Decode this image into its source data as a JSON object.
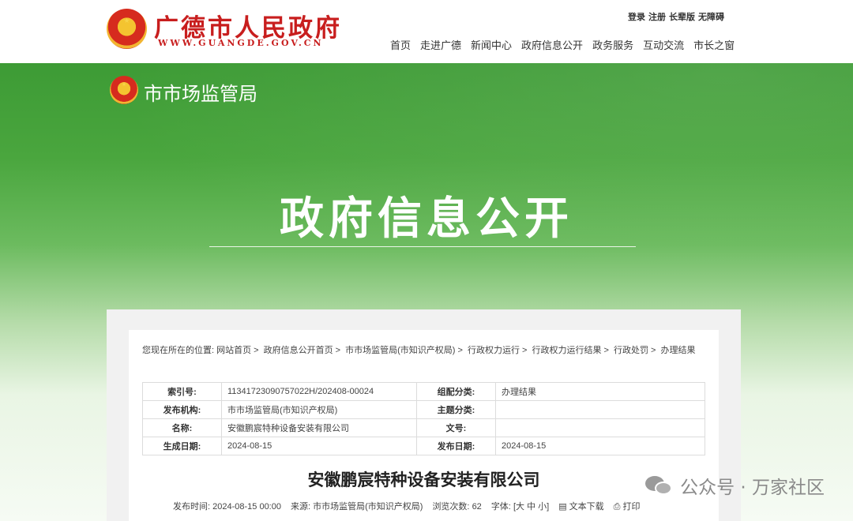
{
  "header": {
    "site_title": "广德市人民政府",
    "site_domain": "WWW.GUANGDE.GOV.CN",
    "util_links": [
      "登录",
      "注册",
      "长辈版",
      "无障碍"
    ],
    "nav": [
      "首页",
      "走进广德",
      "新闻中心",
      "政府信息公开",
      "政务服务",
      "互动交流",
      "市长之窗"
    ]
  },
  "banner": {
    "department": "市市场监管局",
    "title": "政府信息公开"
  },
  "breadcrumb": {
    "prefix": "您现在所在的位置:",
    "items": [
      "网站首页",
      "政府信息公开首页",
      "市市场监管局(市知识产权局)",
      "行政权力运行",
      "行政权力运行结果",
      "行政处罚",
      "办理结果"
    ],
    "separator": ">"
  },
  "meta_table": {
    "rows": [
      {
        "k1": "索引号:",
        "v1": "11341723090757022H/202408-00024",
        "k2": "组配分类:",
        "v2": "办理结果"
      },
      {
        "k1": "发布机构:",
        "v1": "市市场监管局(市知识产权局)",
        "k2": "主题分类:",
        "v2": ""
      },
      {
        "k1": "名称:",
        "v1": "安徽鹏宸特种设备安装有限公司",
        "k2": "文号:",
        "v2": ""
      },
      {
        "k1": "生成日期:",
        "v1": "2024-08-15",
        "k2": "发布日期:",
        "v2": "2024-08-15"
      }
    ]
  },
  "article": {
    "title": "安徽鹏宸特种设备安装有限公司",
    "publish_time_label": "发布时间:",
    "publish_time": "2024-08-15 00:00",
    "source_label": "来源:",
    "source": "市市场监管局(市知识产权局)",
    "views_label": "浏览次数:",
    "views": "62",
    "font_label": "字体:",
    "font_open": "[",
    "font_large": "大",
    "font_medium": "中",
    "font_small": "小",
    "font_close": "]",
    "download_label": "文本下载",
    "print_label": "打印"
  },
  "watermark": {
    "text": "公众号 · 万家社区"
  },
  "colors": {
    "brand_red": "#c81e1e",
    "banner_green": "#3d9b35"
  }
}
